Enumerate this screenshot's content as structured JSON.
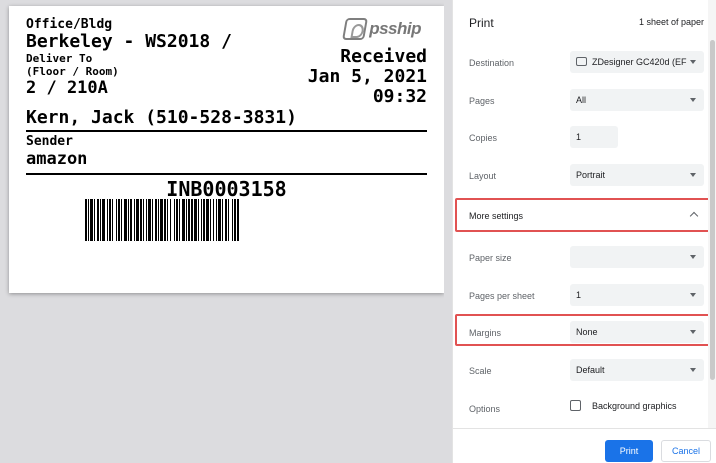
{
  "label": {
    "office_caption": "Office/Bldg",
    "building": "Berkeley - WS2018 /",
    "deliver_to": "Deliver To",
    "floor_room_caption": "(Floor / Room)",
    "room": "2 / 210A",
    "logo_text": "psship",
    "status": "Received",
    "date": "Jan 5, 2021",
    "time": "09:32",
    "contact": "Kern, Jack (510-528-3831)",
    "sender_caption": "Sender",
    "sender": "amazon",
    "tracking": "INB0003158"
  },
  "panel": {
    "title": "Print",
    "sheets": "1 sheet of paper",
    "destination": {
      "label": "Destination",
      "value": "ZDesigner GC420d (EF"
    },
    "pages": {
      "label": "Pages",
      "value": "All"
    },
    "copies": {
      "label": "Copies",
      "value": "1"
    },
    "layout": {
      "label": "Layout",
      "value": "Portrait"
    },
    "more_settings": {
      "label": "More settings"
    },
    "paper_size": {
      "label": "Paper size",
      "value": ""
    },
    "pages_per_sheet": {
      "label": "Pages per sheet",
      "value": "1"
    },
    "margins": {
      "label": "Margins",
      "value": "None"
    },
    "scale": {
      "label": "Scale",
      "value": "Default"
    },
    "options": {
      "label": "Options",
      "checkbox_label": "Background graphics",
      "checked": false
    },
    "print_button": "Print",
    "cancel_button": "Cancel"
  },
  "colors": {
    "accent": "#1a73e8",
    "highlight": "#e15252",
    "preview_bg": "#dcdcdf"
  },
  "icons": [
    "printer-icon",
    "chevron-down-icon",
    "chevron-up-icon",
    "checkbox-icon",
    "psship-logo"
  ]
}
